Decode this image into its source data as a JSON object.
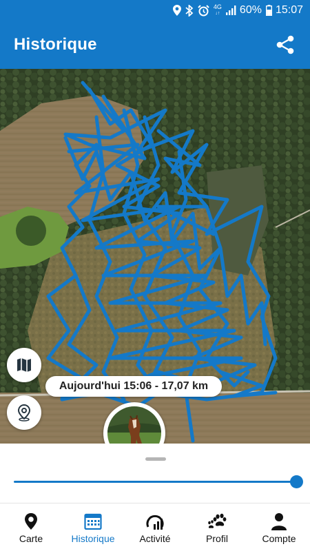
{
  "status_bar": {
    "network": "4G",
    "battery_percent": "60%",
    "time": "15:07",
    "icons": [
      "location-icon",
      "bluetooth-icon",
      "alarm-icon",
      "signal-icon",
      "battery-icon"
    ]
  },
  "app_bar": {
    "title": "Historique",
    "share_icon": "share-icon"
  },
  "map": {
    "track_color": "#1479c8",
    "tooltip": "Aujourd'hui 15:06 - 17,07 km",
    "buttons": [
      "map-layers-icon",
      "location-pin-icon"
    ],
    "marker_image": "horse-photo"
  },
  "timeline": {
    "slider_value_fraction": 1.0
  },
  "nav": {
    "items": [
      {
        "label": "Carte",
        "icon": "map-pin-icon",
        "active": false
      },
      {
        "label": "Historique",
        "icon": "calendar-icon",
        "active": true
      },
      {
        "label": "Activité",
        "icon": "activity-gauge-icon",
        "active": false
      },
      {
        "label": "Profil",
        "icon": "paw-icon",
        "active": false
      },
      {
        "label": "Compte",
        "icon": "person-icon",
        "active": false
      }
    ]
  },
  "colors": {
    "primary": "#1479c8",
    "background": "#ffffff"
  }
}
